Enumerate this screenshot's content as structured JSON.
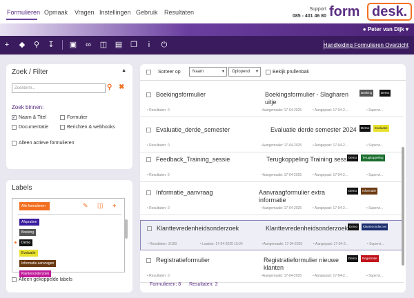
{
  "nav": {
    "tabs": [
      "Formulieren",
      "Opmaak",
      "Vragen",
      "Instellingen",
      "Gebruik",
      "Resultaten"
    ],
    "support_label": "Support",
    "support_phone": "085 - 401 46 80",
    "logo_left": "form",
    "logo_right": "desk."
  },
  "user": {
    "name": "Peter van Dijk"
  },
  "toolbar": {
    "manual": "Handleiding Formulieren Overzicht"
  },
  "filter": {
    "title": "Zoek / Filter",
    "search_placeholder": "Zoekterm...",
    "search_in": "Zoek binnen:",
    "opts": [
      "Naam & Titel",
      "Formulier",
      "Documentatie",
      "Berichten & webhooks",
      "Alleen actieve formulieren"
    ]
  },
  "labels": {
    "title": "Labels",
    "all": "Alle formulieren",
    "items": [
      {
        "t": "Afspraken",
        "c": "#3a1c9e"
      },
      {
        "t": "Boeking",
        "c": "#555555"
      },
      {
        "t": "Demo",
        "c": "#111111"
      },
      {
        "t": "Evaluatie",
        "c": "#e8e02a"
      },
      {
        "t": "Informatie aanvragen",
        "c": "#6b3a12"
      },
      {
        "t": "Klantenonderzoek",
        "c": "#c01a9a"
      }
    ],
    "only_linked": "Alleen gekoppelde labels"
  },
  "list": {
    "sort_label": "Sorteer op",
    "sort_field": "Naam",
    "sort_dir": "Oplopend",
    "trash": "Bekijk prullenbak",
    "rows": [
      {
        "name": "Boekingsformulier",
        "title": "Boekingsformulier - Slagharen uitje",
        "res": "Resultaten: 0",
        "last": "",
        "created": "Aangemaakt: 17-04-2025",
        "changed": "Aangepast: 17-04-2...",
        "sup": "Supervi...",
        "tags": [
          {
            "t": "Boeking",
            "c": "#555555"
          },
          {
            "t": "Demo",
            "c": "#111111"
          }
        ]
      },
      {
        "name": "Evaluatie_derde_semester",
        "title": "Evaluatie derde semester 2024",
        "res": "Resultaten: 0",
        "last": "",
        "created": "Aangemaakt: 17-04-2025",
        "changed": "Aangepast: 17-04-2...",
        "sup": "Supervi...",
        "tags": [
          {
            "t": "Demo",
            "c": "#111111"
          },
          {
            "t": "Evaluatie",
            "c": "#e8e02a"
          }
        ]
      },
      {
        "name": "Feedback_Training_sessie",
        "title": "Terugkoppeling Training sessie",
        "res": "Resultaten: 0",
        "last": "",
        "created": "Aangemaakt: 17-04-2025",
        "changed": "Aangepast: 17-04-2...",
        "sup": "Supervi...",
        "tags": [
          {
            "t": "Demo",
            "c": "#111111"
          },
          {
            "t": "Terugkoppeling",
            "c": "#1a6e2e"
          }
        ]
      },
      {
        "name": "Informatie_aanvraag",
        "title": "Aanvraagformulier extra informatie",
        "res": "Resultaten: 0",
        "last": "",
        "created": "Aangemaakt: 17-04-2025",
        "changed": "Aangepast: 17-04-2...",
        "sup": "Supervi...",
        "tags": [
          {
            "t": "Demo",
            "c": "#111111"
          },
          {
            "t": "Informatie",
            "c": "#6b3a12"
          }
        ]
      },
      {
        "name": "Klanttevredenheidsonderzoek",
        "title": "Klanttevredenheidsonderzoek",
        "res": "Resultaten: 3/100",
        "last": "Laatste: 17-04-2025 15:24",
        "created": "Aangemaakt: 17-04-2025",
        "changed": "Aangepast: 17-04-2...",
        "sup": "Supervi...",
        "tags": [
          {
            "t": "Demo",
            "c": "#111111"
          },
          {
            "t": "Klantenonderzoe",
            "c": "#1a2e6e"
          }
        ]
      },
      {
        "name": "Registratieformulier",
        "title": "Registratieformulier nieuwe klanten",
        "res": "Resultaten: 0",
        "last": "",
        "created": "Aangemaakt: 17-04-2025",
        "changed": "Aangepast: 17-04-2...",
        "sup": "Supervi...",
        "tags": [
          {
            "t": "Demo",
            "c": "#111111"
          },
          {
            "t": "Registratie",
            "c": "#c0121a"
          }
        ]
      }
    ],
    "footer_forms": "Formulieren: 8",
    "footer_results": "Resultaten: 3"
  }
}
